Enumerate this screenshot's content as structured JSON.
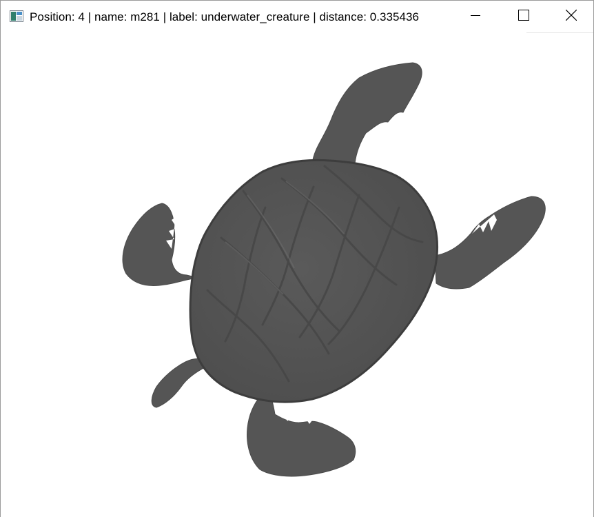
{
  "window": {
    "title": "Position: 4 | name: m281 | label: underwater_creature | distance: 0.335436",
    "app_icon": "image-viewer-icon",
    "controls": {
      "minimize_icon": "minimize-icon",
      "maximize_icon": "maximize-icon",
      "close_icon": "close-icon"
    }
  },
  "viewport": {
    "subject_icon": "sea-turtle-render",
    "background_color": "#ffffff",
    "model_color": "#555555"
  }
}
